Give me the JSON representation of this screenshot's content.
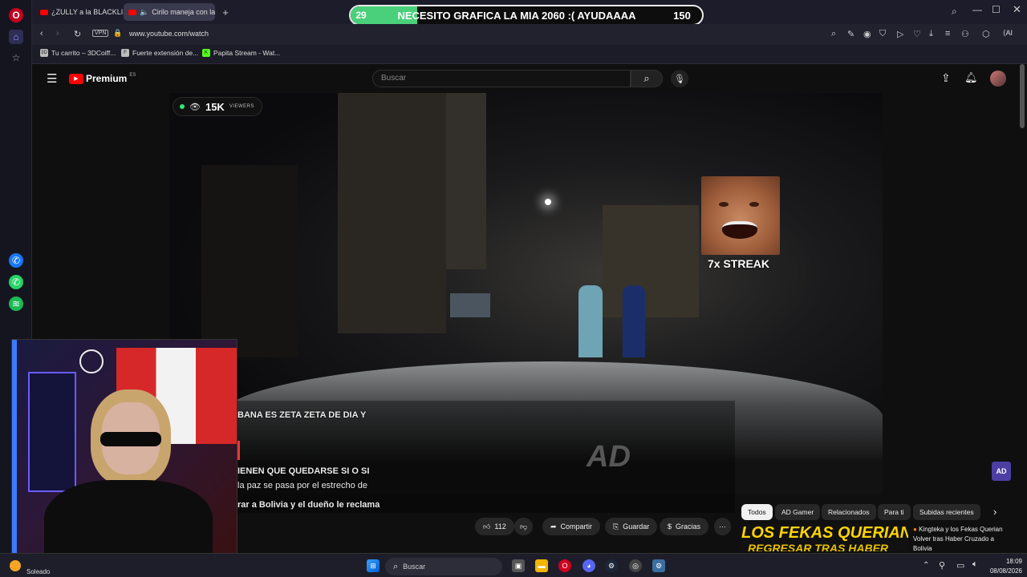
{
  "browser": {
    "tabs": [
      {
        "label": "¿ZULLY a la BLACKLIST"
      },
      {
        "label": "Cirilo maneja con la B"
      }
    ],
    "vpn_label": "VPN",
    "url": "www.youtube.com/watch",
    "ai_label": "AI",
    "bookmarks": [
      {
        "label": "Tu carrito – 3DCoiff..."
      },
      {
        "label": "Fuerte extensión de..."
      },
      {
        "label": "Papita Stream - Wat..."
      }
    ]
  },
  "donation_banner": {
    "left_count": "29",
    "message": "NECESITO GRAFICA LA MIA 2060 :( AYUDAAAA",
    "right_count": "150",
    "progress_fraction": 0.19,
    "fill_color": "#4ad07a"
  },
  "youtube": {
    "logo_text": "Premium",
    "region": "ES",
    "search_placeholder": "Buscar"
  },
  "overlay": {
    "viewers_count": "15K",
    "viewers_label": "VIEWERS",
    "streak_label": "7x STREAK",
    "video_logo": "AD"
  },
  "chat_lines": [
    "BANA ES ZETA ZETA DE DIA Y",
    "IENEN QUE QUEDARSE SI O SI",
    "la paz se pasa por el estrecho de",
    "rar a Bolivia y el dueño le reclama"
  ],
  "actions": {
    "likes": "112",
    "share": "Compartir",
    "save": "Guardar",
    "thanks": "Gracias"
  },
  "chips": [
    "Todos",
    "AD Gamer",
    "Relacionados",
    "Para ti",
    "Subidas recientes"
  ],
  "related": {
    "thumb_text": "LOS FEKAS QUERIAN",
    "thumb_sub": "REGRESAR TRAS HABER",
    "title_line1": "Kingteka y los Fekas Querian",
    "title_line2": "Volver tras Haber Cruzado a",
    "title_line3": "Bolivia"
  },
  "taskbar": {
    "weather": "Soleado",
    "search_label": "Buscar",
    "time": "18:09",
    "date": "08/08/2026"
  },
  "colors": {
    "accent_red": "#ff0000",
    "opera_red": "#e4002b",
    "donation_green": "#4ad07a"
  }
}
